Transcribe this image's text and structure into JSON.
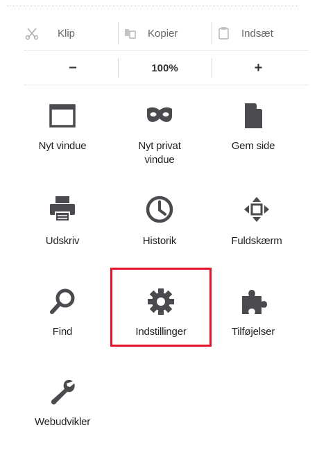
{
  "edit_controls": {
    "cut_label": "Klip",
    "copy_label": "Kopier",
    "paste_label": "Indsæt"
  },
  "zoom_controls": {
    "zoom_out_label": "−",
    "zoom_level": "100%",
    "zoom_in_label": "+"
  },
  "menu_items": {
    "new_window": "Nyt vindue",
    "new_private_window_line1": "Nyt privat",
    "new_private_window_line2": "vindue",
    "save_page": "Gem side",
    "print": "Udskriv",
    "history": "Historik",
    "fullscreen": "Fuldskærm",
    "find": "Find",
    "settings": "Indstillinger",
    "addons": "Tilføjelser",
    "web_developer": "Webudvikler"
  },
  "colors": {
    "icon": "#4a4a4f",
    "highlight": "#e8132b"
  }
}
